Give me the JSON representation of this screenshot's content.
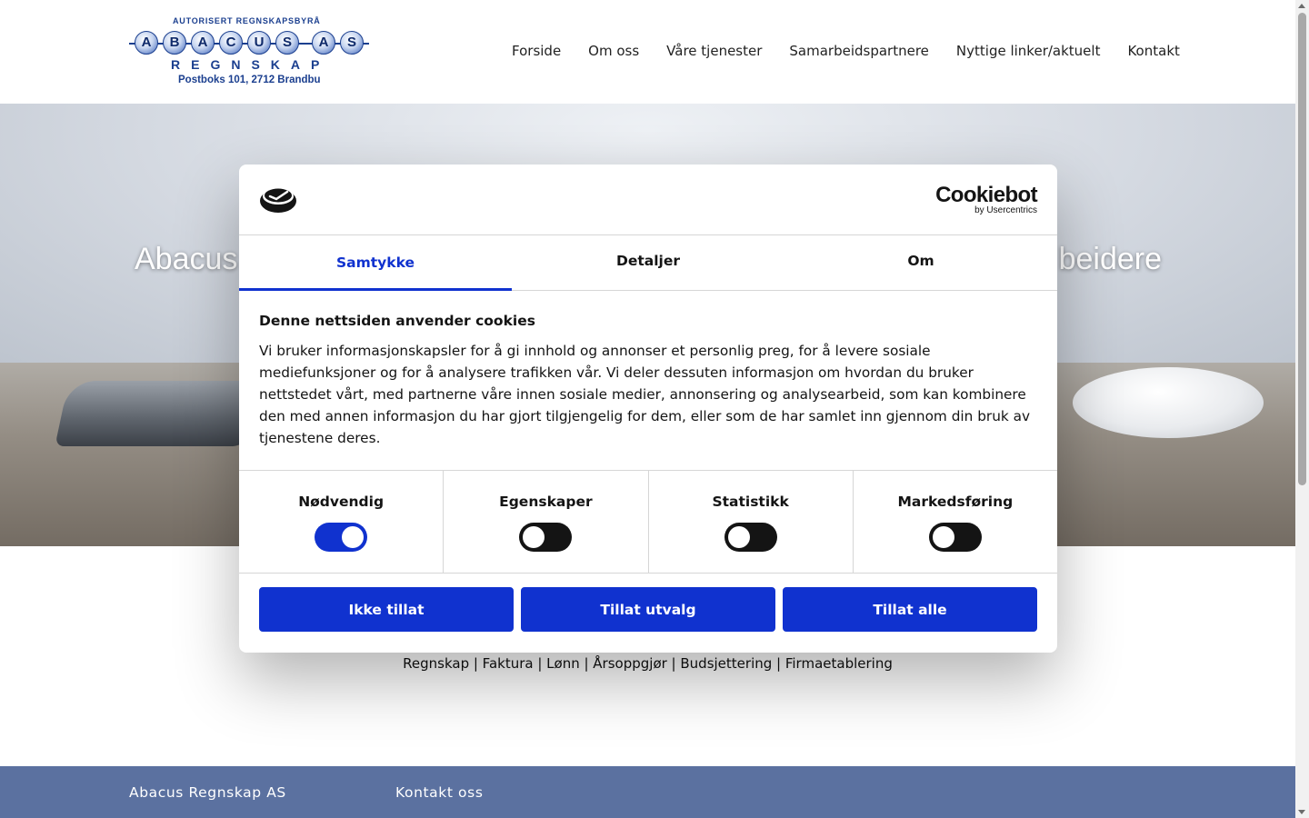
{
  "logo": {
    "tagline": "AUTORISERT REGNSKAPSBYRÅ",
    "beads": [
      "A",
      "B",
      "A",
      "C",
      "U",
      "S",
      "A",
      "S"
    ],
    "subtitle": "REGNSKAP",
    "address": "Postboks 101,  2712 Brandbu"
  },
  "nav": {
    "items": [
      "Forside",
      "Om oss",
      "Våre tjenester",
      "Samarbeidspartnere",
      "Nyttige linker/aktuelt",
      "Kontakt"
    ]
  },
  "hero": {
    "title_left": "Abacus",
    "title_right": "beidere"
  },
  "services": {
    "text": "Regnskap | Faktura | Lønn | Årsoppgjør | Budsjettering | Firmaetablering"
  },
  "footer": {
    "company": "Abacus Regnskap AS",
    "contact_heading": "Kontakt oss"
  },
  "cookie_dialog": {
    "brand": "Cookiebot",
    "brand_sub": "by Usercentrics",
    "tabs": [
      "Samtykke",
      "Detaljer",
      "Om"
    ],
    "active_tab": "Samtykke",
    "heading": "Denne nettsiden anvender cookies",
    "body": "Vi bruker informasjonskapsler for å gi innhold og annonser et personlig preg, for å levere sosiale mediefunksjoner og for å analysere trafikken vår. Vi deler dessuten informasjon om hvordan du bruker nettstedet vårt, med partnerne våre innen sosiale medier, annonsering og analysearbeid, som kan kombinere den med annen informasjon du har gjort tilgjengelig for dem, eller som de har samlet inn gjennom din bruk av tjenestene deres.",
    "toggles": [
      {
        "label": "Nødvendig",
        "on": true
      },
      {
        "label": "Egenskaper",
        "on": false
      },
      {
        "label": "Statistikk",
        "on": false
      },
      {
        "label": "Markedsføring",
        "on": false
      }
    ],
    "buttons": {
      "deny": "Ikke tillat",
      "selection": "Tillat utvalg",
      "all": "Tillat alle"
    },
    "accent_color": "#1032cf"
  }
}
